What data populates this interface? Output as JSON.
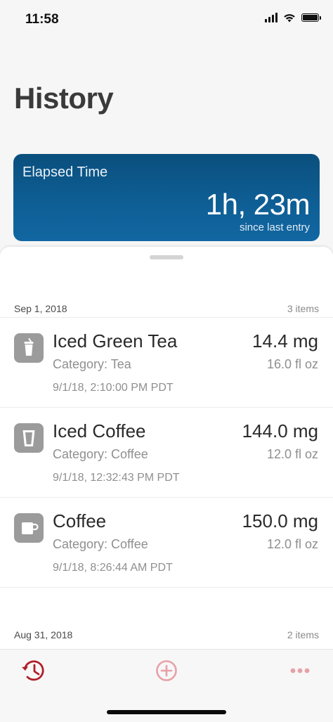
{
  "status_bar": {
    "time": "11:58"
  },
  "page": {
    "title": "History"
  },
  "elapsed": {
    "label": "Elapsed Time",
    "value": "1h, 23m",
    "subtitle": "since last entry"
  },
  "sections": [
    {
      "date": "Sep 1, 2018",
      "count": "3 items",
      "entries": [
        {
          "name": "Iced Green Tea",
          "category": "Category: Tea",
          "timestamp": "9/1/18, 2:10:00 PM PDT",
          "amount": "14.4 mg",
          "volume": "16.0 fl oz",
          "icon": "iced-cup-icon"
        },
        {
          "name": "Iced Coffee",
          "category": "Category: Coffee",
          "timestamp": "9/1/18, 12:32:43 PM PDT",
          "amount": "144.0 mg",
          "volume": "12.0 fl oz",
          "icon": "tall-cup-icon"
        },
        {
          "name": "Coffee",
          "category": "Category: Coffee",
          "timestamp": "9/1/18, 8:26:44 AM PDT",
          "amount": "150.0 mg",
          "volume": "12.0 fl oz",
          "icon": "mug-icon"
        }
      ]
    },
    {
      "date": "Aug 31, 2018",
      "count": "2 items"
    }
  ],
  "tab_bar": {
    "tabs": [
      {
        "icon": "history-clock-icon",
        "active": true
      },
      {
        "icon": "add-circle-icon",
        "active": false
      },
      {
        "icon": "more-dots-icon",
        "active": false
      }
    ]
  },
  "colors": {
    "card_gradient_top": "#0a4f7d",
    "card_gradient_bottom": "#1267a2",
    "tab_active": "#b01e2a",
    "tab_inactive": "#e8a0a8",
    "icon_tile": "#9b9b9b"
  }
}
